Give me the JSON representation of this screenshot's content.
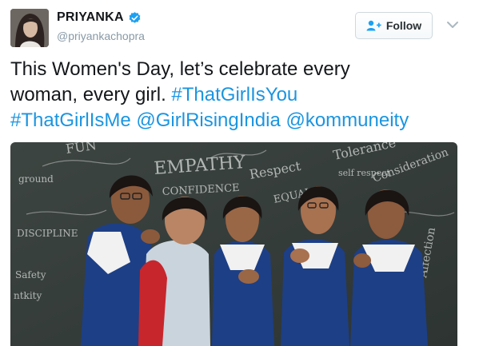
{
  "header": {
    "display_name": "PRIYANKA",
    "handle": "@priyankachopra",
    "follow_label": "Follow"
  },
  "tweet": {
    "line1": "This Women's Day, let’s celebrate every",
    "line2_prefix": "woman, every girl. ",
    "hashtag_you": "#ThatGirlIsYou",
    "hashtag_me": "#ThatGirlIsMe",
    "mention_girlrising": "@GirlRisingIndia",
    "mention_kommuneity": "@kommuneity"
  },
  "colors": {
    "link": "#1b95e0",
    "verified_badge": "#1da1f2",
    "text": "#14171a",
    "muted": "#8899a6"
  },
  "icons": {
    "verified": "verified-badge-icon",
    "follow": "add-user-icon",
    "menu": "chevron-down-icon"
  }
}
